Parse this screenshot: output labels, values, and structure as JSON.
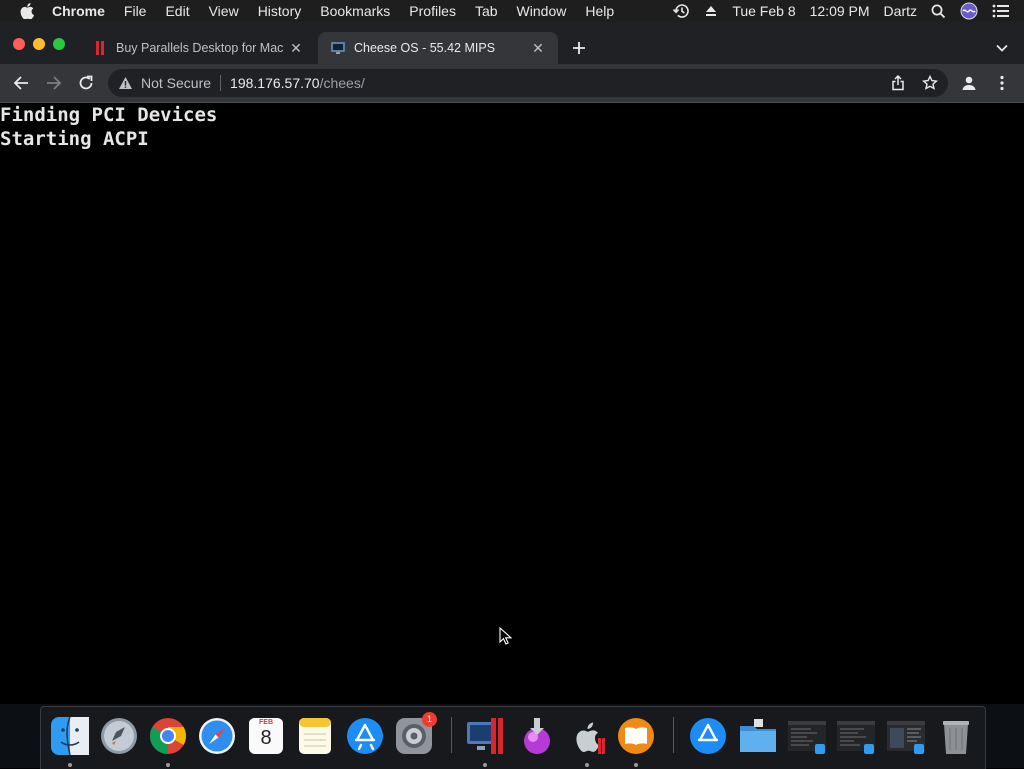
{
  "menubar": {
    "app_name": "Chrome",
    "items": [
      "File",
      "Edit",
      "View",
      "History",
      "Bookmarks",
      "Profiles",
      "Tab",
      "Window",
      "Help"
    ],
    "date": "Tue Feb 8",
    "time": "12:09 PM",
    "user": "Dartz"
  },
  "tabs": [
    {
      "title": "Buy Parallels Desktop for Mac",
      "active": false
    },
    {
      "title": "Cheese OS - 55.42 MIPS",
      "active": true
    }
  ],
  "toolbar": {
    "security_label": "Not Secure",
    "url_host": "198.176.57.70",
    "url_path": "/chees/"
  },
  "page": {
    "console_lines": [
      "Finding PCI Devices",
      "Starting ACPI"
    ]
  },
  "dock": {
    "calendar_month": "FEB",
    "calendar_day": "8",
    "settings_badge": "1"
  },
  "colors": {
    "menubar_bg": "#1e1e1e",
    "tabstrip_bg": "#202124",
    "toolbar_bg": "#35363a",
    "page_bg": "#000000",
    "traffic_red": "#ff5f57",
    "traffic_yellow": "#febc2e",
    "traffic_green": "#28c840"
  }
}
